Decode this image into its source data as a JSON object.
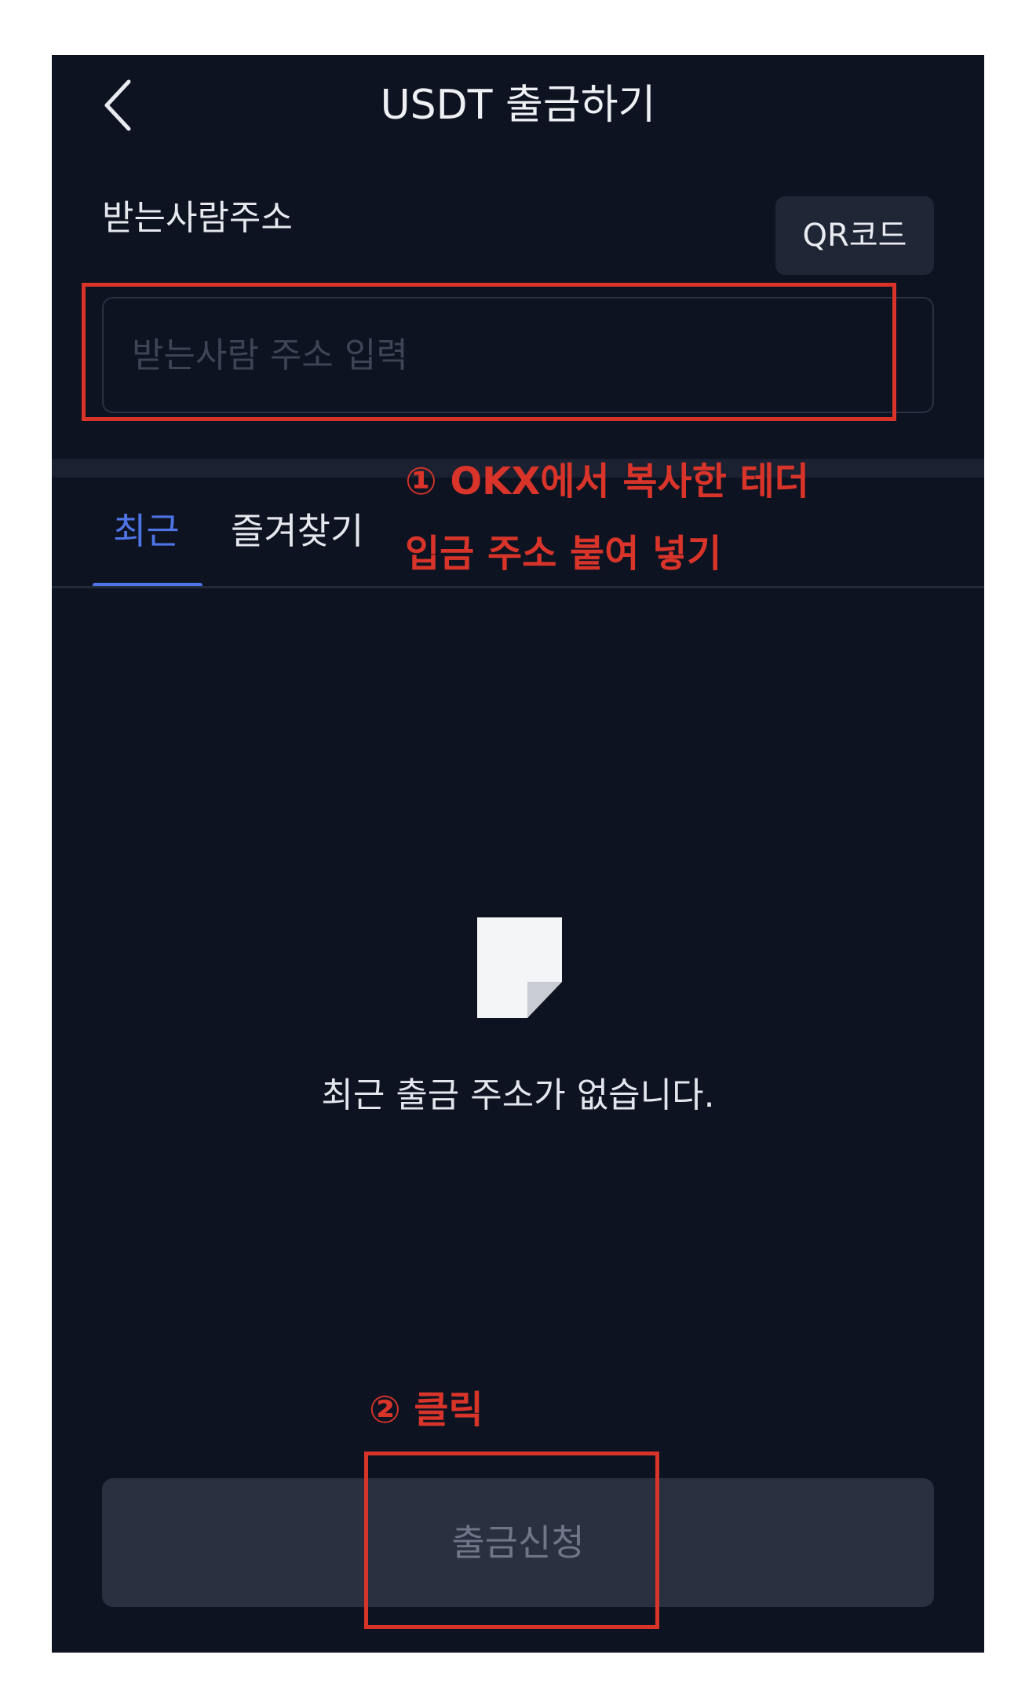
{
  "header": {
    "title": "USDT 출금하기",
    "back_icon": "chevron-left-icon"
  },
  "address": {
    "label": "받는사람주소",
    "qr_button_label": "QR코드",
    "input_value": "",
    "input_placeholder": "받는사람 주소 입력"
  },
  "tabs": [
    {
      "label": "최근",
      "active": true
    },
    {
      "label": "즐겨찾기",
      "active": false
    }
  ],
  "empty_state": {
    "icon": "document-icon",
    "message": "최근 출금 주소가 없습니다."
  },
  "submit": {
    "label": "출금신청",
    "enabled": false
  },
  "annotations": {
    "step1_line1": "① OKX에서 복사한 테더",
    "step1_line2": "입금 주소 붙여 넣기",
    "step2": "② 클릭"
  },
  "colors": {
    "background": "#0d1321",
    "accent": "#4f74e6",
    "annotation": "#d8342a",
    "button_disabled": "#2a3040"
  }
}
